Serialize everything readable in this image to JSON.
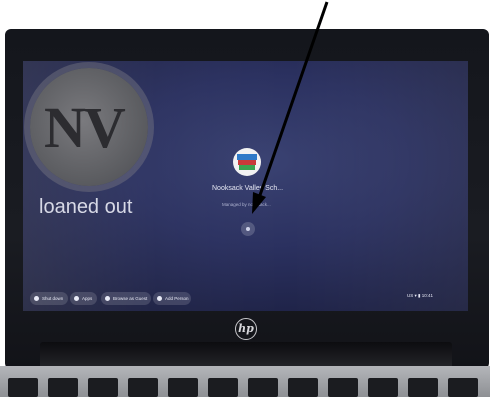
{
  "login_screen": {
    "logo_text": "NV",
    "device_status": "loaned out",
    "user_pod": {
      "name": "Nooksack Valley Sch...",
      "sub_label": "Managed by nooksack..."
    }
  },
  "shelf": {
    "shutdown_label": "Shut down",
    "apps_label": "Apps",
    "browse_label": "Browse as Guest",
    "add_person_label": "Add Person",
    "tray_text": "US ▾ ▮ 10:41"
  },
  "laptop": {
    "brand": "hp"
  },
  "colors": {
    "screen_bg": "#2b3160",
    "annotation_arrow": "#000000"
  }
}
